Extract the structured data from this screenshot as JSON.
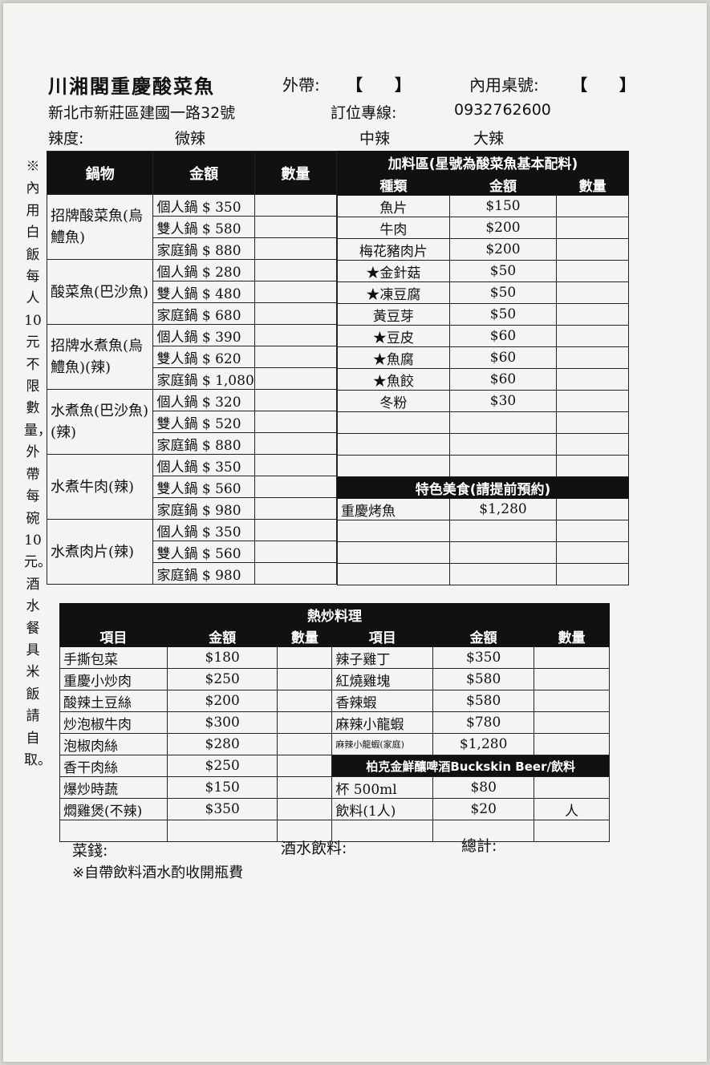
{
  "header": {
    "restaurant_name": "川湘閣重慶酸菜魚",
    "takeout_label": "外帶:",
    "takeout_brackets": "【　　】",
    "dinein_label": "內用桌號:",
    "dinein_brackets": "【　　】",
    "address": "新北市新莊區建國一路32號",
    "phone_label": "訂位專線:",
    "phone": "0932762600",
    "spice_label": "辣度:",
    "spice_mild": "微辣",
    "spice_medium": "中辣",
    "spice_hot": "大辣"
  },
  "side_note": "※內用白飯每人10元不限數量，外帶每碗10元。酒水餐具米飯請自取。",
  "pot_section": {
    "headers": [
      "鍋物",
      "金額",
      "數量"
    ],
    "dishes": [
      {
        "name": "招牌酸菜魚(烏鱧魚)",
        "prices": [
          "個人鍋 $ 350",
          "雙人鍋 $ 580",
          "家庭鍋 $ 880"
        ]
      },
      {
        "name": "酸菜魚(巴沙魚)",
        "prices": [
          "個人鍋 $ 280",
          "雙人鍋 $ 480",
          "家庭鍋 $ 680"
        ]
      },
      {
        "name": "招牌水煮魚(烏鱧魚)(辣)",
        "prices": [
          "個人鍋 $ 390",
          "雙人鍋 $ 620",
          "家庭鍋 $ 1,080"
        ]
      },
      {
        "name": "水煮魚(巴沙魚)(辣)",
        "prices": [
          "個人鍋 $ 320",
          "雙人鍋 $ 520",
          "家庭鍋 $ 880"
        ]
      },
      {
        "name": "水煮牛肉(辣)",
        "prices": [
          "個人鍋 $ 350",
          "雙人鍋 $ 560",
          "家庭鍋 $ 980"
        ]
      },
      {
        "name": "水煮肉片(辣)",
        "prices": [
          "個人鍋 $ 350",
          "雙人鍋 $ 560",
          "家庭鍋 $ 980"
        ]
      }
    ]
  },
  "addon_section": {
    "title": "加料區(星號為酸菜魚基本配料)",
    "headers": [
      "種類",
      "金額",
      "數量"
    ],
    "items": [
      {
        "name": "魚片",
        "price": "$150"
      },
      {
        "name": "牛肉",
        "price": "$200"
      },
      {
        "name": "梅花豬肉片",
        "price": "$200"
      },
      {
        "name": "★金針菇",
        "price": "$50"
      },
      {
        "name": "★凍豆腐",
        "price": "$50"
      },
      {
        "name": "黃豆芽",
        "price": "$50"
      },
      {
        "name": "★豆皮",
        "price": "$60"
      },
      {
        "name": "★魚腐",
        "price": "$60"
      },
      {
        "name": "★魚餃",
        "price": "$60"
      },
      {
        "name": "冬粉",
        "price": "$30"
      }
    ]
  },
  "special_section": {
    "title": "特色美食(請提前預約)",
    "items": [
      {
        "name": "重慶烤魚",
        "price": "$1,280"
      }
    ]
  },
  "stirfry_section": {
    "title": "熱炒料理",
    "headers": [
      "項目",
      "金額",
      "數量",
      "項目",
      "金額",
      "數量"
    ],
    "left_items": [
      {
        "name": "手撕包菜",
        "price": "$180"
      },
      {
        "name": "重慶小炒肉",
        "price": "$250"
      },
      {
        "name": "酸辣土豆絲",
        "price": "$200"
      },
      {
        "name": "炒泡椒牛肉",
        "price": "$300"
      },
      {
        "name": "泡椒肉絲",
        "price": "$280"
      },
      {
        "name": "香干肉絲",
        "price": "$250"
      },
      {
        "name": "爆炒時蔬",
        "price": "$150"
      },
      {
        "name": "燜雞煲(不辣)",
        "price": "$350"
      }
    ],
    "right_items": [
      {
        "name": "辣子雞丁",
        "price": "$350"
      },
      {
        "name": "紅燒雞塊",
        "price": "$580"
      },
      {
        "name": "香辣蝦",
        "price": "$580"
      },
      {
        "name": "麻辣小龍蝦",
        "price": "$780"
      },
      {
        "name": "麻辣小龍蝦(家庭)",
        "price": "$1,280"
      }
    ],
    "beer_title": "柏克金鮮釀啤酒Buckskin Beer/飲料",
    "beer_items": [
      {
        "name": "杯 500ml",
        "price": "$80",
        "qty": ""
      },
      {
        "name": "飲料(1人)",
        "price": "$20",
        "qty": "人"
      }
    ]
  },
  "footer": {
    "dish_total_label": "菜錢:",
    "drink_total_label": "酒水飲料:",
    "grand_total_label": "總計:",
    "note": "※自帶飲料酒水酌收開瓶費"
  }
}
